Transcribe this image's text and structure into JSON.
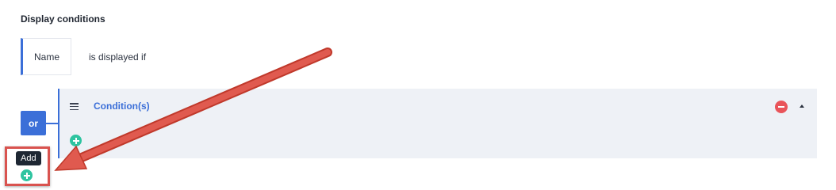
{
  "section": {
    "title": "Display conditions"
  },
  "field": {
    "name": "Name",
    "suffix": "is displayed if"
  },
  "logic": {
    "operator": "or"
  },
  "condition_group": {
    "title": "Condition(s)"
  },
  "tooltip": {
    "text": "Add"
  },
  "icons": {
    "menu": "hamburger-menu-icon",
    "remove": "minus-circle-icon",
    "collapse": "caret-up-icon",
    "add": "plus-circle-icon",
    "annotation": "red-arrow-annotation"
  },
  "colors": {
    "accent": "#3b6fd8",
    "panel_bg": "#eef1f6",
    "remove": "#e9545a",
    "add": "#2ec4a0",
    "annotation": "#d9534f",
    "tooltip_bg": "#1e2733"
  }
}
